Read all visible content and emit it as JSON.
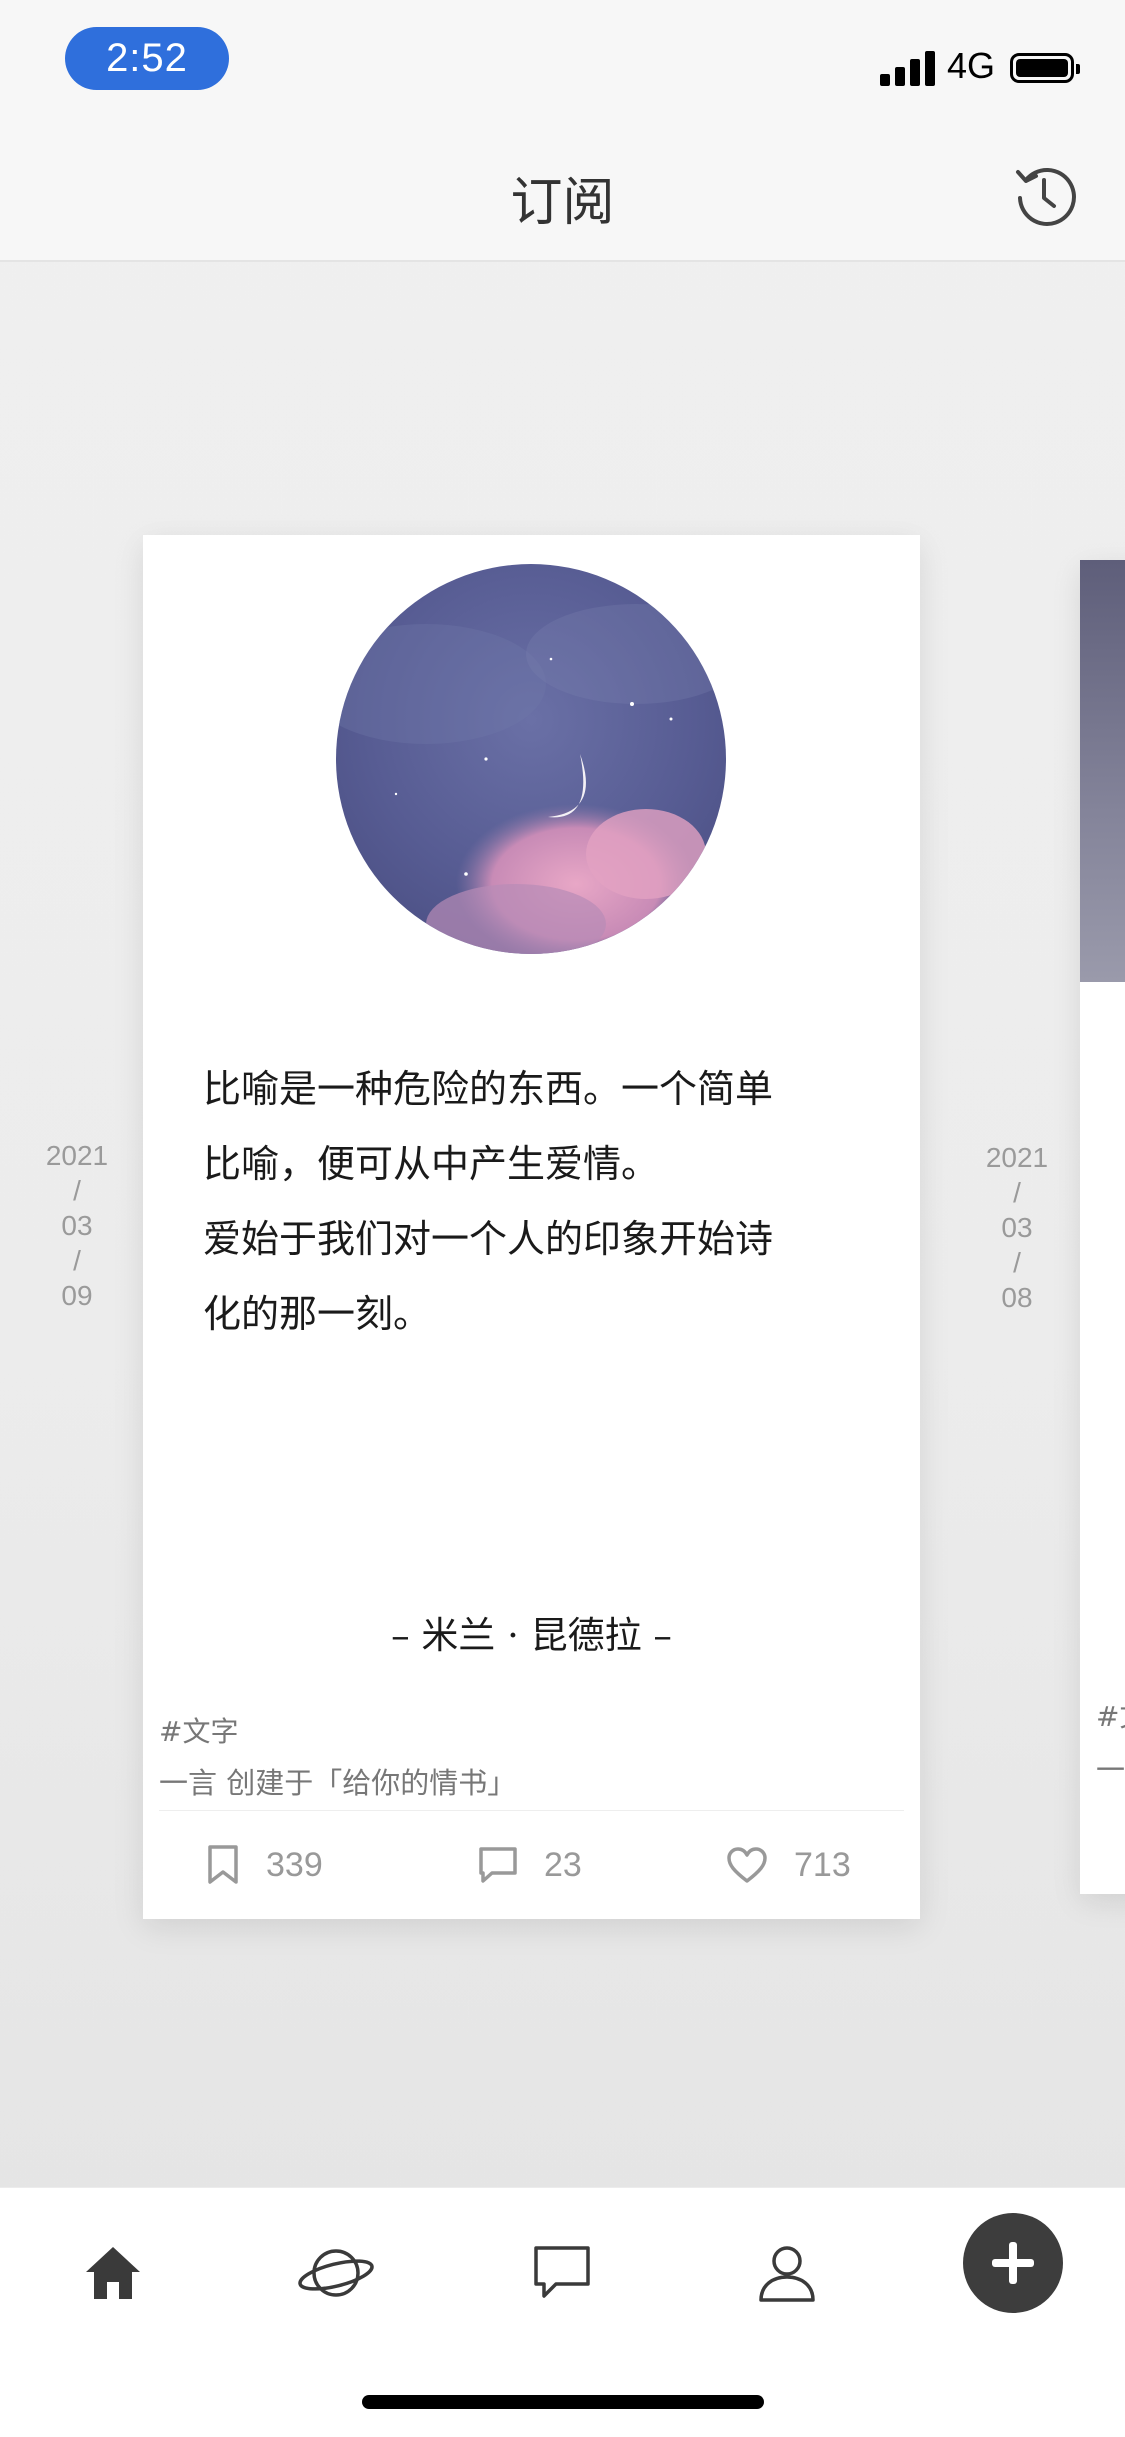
{
  "status_bar": {
    "time": "2:52",
    "network": "4G"
  },
  "nav": {
    "title": "订阅",
    "history_icon": "history-clock-icon"
  },
  "dates": {
    "left": {
      "year": "2021",
      "sep1": "/",
      "month": "03",
      "sep2": "/",
      "day": "09"
    },
    "right": {
      "year": "2021",
      "sep1": "/",
      "month": "03",
      "sep2": "/",
      "day": "08"
    }
  },
  "card": {
    "image": "crescent-moon-night-sky-image",
    "quote_lines": [
      "比喻是一种危险的东西。一个简单",
      "比喻，便可从中产生爱情。",
      "爱始于我们对一个人的印象开始诗",
      "化的那一刻。"
    ],
    "author": "– 米兰 · 昆德拉 –",
    "tag": "#文字",
    "source": "一言 创建于「给你的情书」",
    "actions": {
      "bookmarks": "339",
      "comments": "23",
      "likes": "713"
    }
  },
  "next_card": {
    "tag": "#文",
    "source": "一"
  },
  "tabbar": {
    "items": [
      {
        "icon": "home-icon"
      },
      {
        "icon": "planet-icon"
      },
      {
        "icon": "chat-bubble-icon"
      },
      {
        "icon": "user-icon"
      },
      {
        "icon": "plus-icon"
      }
    ]
  },
  "colors": {
    "time_pill": "#2f6fdc",
    "add_button": "#3d3d3d"
  }
}
